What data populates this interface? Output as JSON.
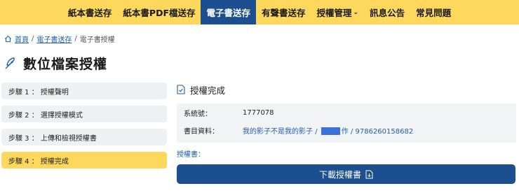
{
  "nav": {
    "items": [
      {
        "label": "紙本書送存"
      },
      {
        "label": "紙本書PDF檔送存"
      },
      {
        "label": "電子書送存"
      },
      {
        "label": "有聲書送存"
      },
      {
        "label": "授權管理"
      },
      {
        "label": "訊息公告"
      },
      {
        "label": "常見問題"
      }
    ],
    "active_index": 2,
    "colors": {
      "bar": "#fdd85d",
      "active": "#1c4f8f"
    }
  },
  "breadcrumb": {
    "home": "首頁",
    "sep": "/",
    "parent": "電子書送存",
    "current": "電子書授權"
  },
  "page": {
    "title": "數位檔案授權",
    "icon": "feather-icon"
  },
  "steps": [
    {
      "label": "步驟 1 ： 授權聲明"
    },
    {
      "label": "步驟 2 ： 選擇授權模式"
    },
    {
      "label": "步驟 3 ： 上傳和檢視授權書"
    },
    {
      "label": "步驟 4 ： 授權完成"
    }
  ],
  "active_step": 4,
  "section": {
    "title": "授權完成",
    "icon": "doc-check-icon"
  },
  "info": {
    "system_no_label": "系統號：",
    "system_no": "1777078",
    "book_label": "書目資料：",
    "book_title": "我的影子不是我的影子",
    "sep1": "/",
    "author_suffix": "作",
    "sep2": "/",
    "isbn": "9786260158682"
  },
  "auth_label": "授權書：",
  "download": {
    "label": "下載授權書",
    "icon": "download-doc-icon"
  }
}
